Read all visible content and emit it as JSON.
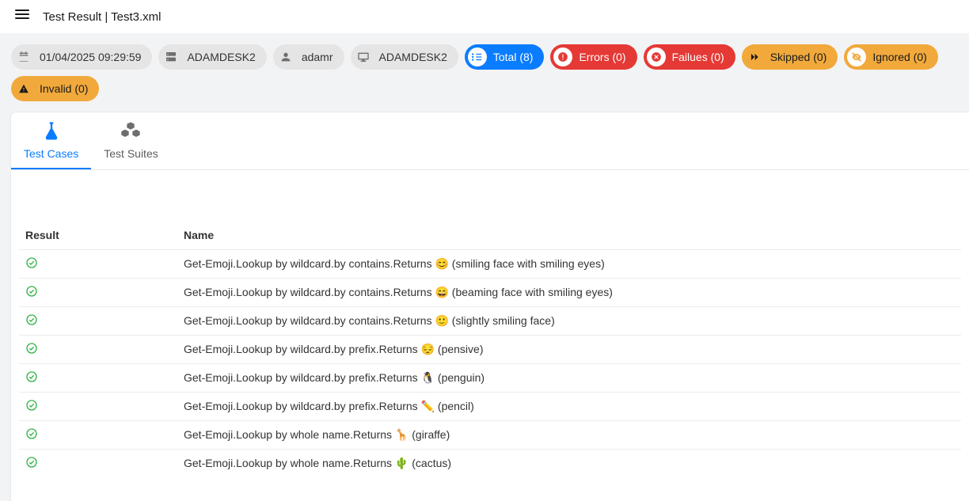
{
  "header": {
    "title": "Test Result | Test3.xml"
  },
  "meta": {
    "datetime": "01/04/2025 09:29:59",
    "host": "ADAMDESK2",
    "user": "adamr",
    "machine": "ADAMDESK2"
  },
  "summary": {
    "total": "Total (8)",
    "errors": "Errors (0)",
    "failures": "Failues (0)",
    "skipped": "Skipped (0)",
    "ignored": "Ignored (0)",
    "invalid": "Invalid (0)"
  },
  "tabs": {
    "cases": "Test Cases",
    "suites": "Test Suites"
  },
  "table": {
    "col_result": "Result",
    "col_name": "Name",
    "rows": [
      {
        "pre": "Get-Emoji.Lookup by wildcard.by contains.Returns ",
        "emoji": "😊",
        "post": "  (smiling face with smiling eyes)"
      },
      {
        "pre": "Get-Emoji.Lookup by wildcard.by contains.Returns ",
        "emoji": "😄",
        "post": "  (beaming face with smiling eyes)"
      },
      {
        "pre": "Get-Emoji.Lookup by wildcard.by contains.Returns ",
        "emoji": "🙂",
        "post": "  (slightly smiling face)"
      },
      {
        "pre": "Get-Emoji.Lookup by wildcard.by prefix.Returns ",
        "emoji": "😔",
        "post": "  (pensive)"
      },
      {
        "pre": "Get-Emoji.Lookup by wildcard.by prefix.Returns ",
        "emoji": "🐧",
        "post": "  (penguin)"
      },
      {
        "pre": "Get-Emoji.Lookup by wildcard.by prefix.Returns ",
        "emoji": "✏️",
        "post": "  (pencil)"
      },
      {
        "pre": "Get-Emoji.Lookup by whole name.Returns ",
        "emoji": "🦒",
        "post": "  (giraffe)"
      },
      {
        "pre": "Get-Emoji.Lookup by whole name.Returns ",
        "emoji": "🌵",
        "post": "  (cactus)"
      }
    ]
  }
}
